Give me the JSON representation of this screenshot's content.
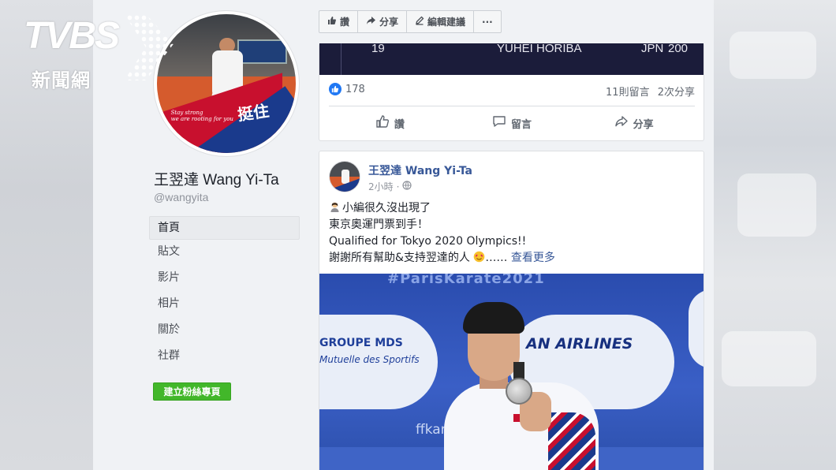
{
  "watermark": {
    "brand": "TVBS",
    "sub": "新聞網",
    "icon": "tvbs-dots-icon"
  },
  "toolbar": {
    "like_label": "讚",
    "share_label": "分享",
    "edit_label": "編輯建議",
    "more_label": "···"
  },
  "profile": {
    "name": "王翌達 Wang Yi-Ta",
    "handle": "@wangyita",
    "avatar_text_en": "Stay strong\nwe are rooting for you",
    "avatar_text_zh": "挺住"
  },
  "nav": {
    "items": [
      {
        "label": "首頁",
        "active": true
      },
      {
        "label": "貼文",
        "active": false
      },
      {
        "label": "影片",
        "active": false
      },
      {
        "label": "相片",
        "active": false
      },
      {
        "label": "關於",
        "active": false
      },
      {
        "label": "社群",
        "active": false
      }
    ],
    "create_button": "建立粉絲專頁"
  },
  "prev_post": {
    "ranking_row": {
      "rank": "19",
      "athlete": "YUHEI HORIBA",
      "country": "JPN",
      "points": "200"
    },
    "like_count": "178",
    "comment_count": "11則留言",
    "share_count": "2次分享",
    "actions": {
      "like": "讚",
      "comment": "留言",
      "share": "分享"
    }
  },
  "post": {
    "author": "王翌達 Wang Yi-Ta",
    "time": "2小時",
    "lines": [
      "小編很久沒出現了",
      "東京奧運門票到手！",
      "Qualified for Tokyo 2020 Olympics!!",
      "謝謝所有幫助&支持翌達的人"
    ],
    "ellipsis": "……",
    "see_more": "查看更多",
    "photo": {
      "hashtag": "#ParisKarate2021",
      "sponsor1_line1": "GROUPE MDS",
      "sponsor1_line2": "Mutuelle des Sportifs",
      "sponsor2": "AN AIRLINES",
      "sponsor3": "ffkar"
    }
  },
  "colors": {
    "fb_blue": "#385898",
    "like_blue": "#2078f4",
    "create_green": "#42b72a",
    "page_bg": "#f0f2f5"
  }
}
